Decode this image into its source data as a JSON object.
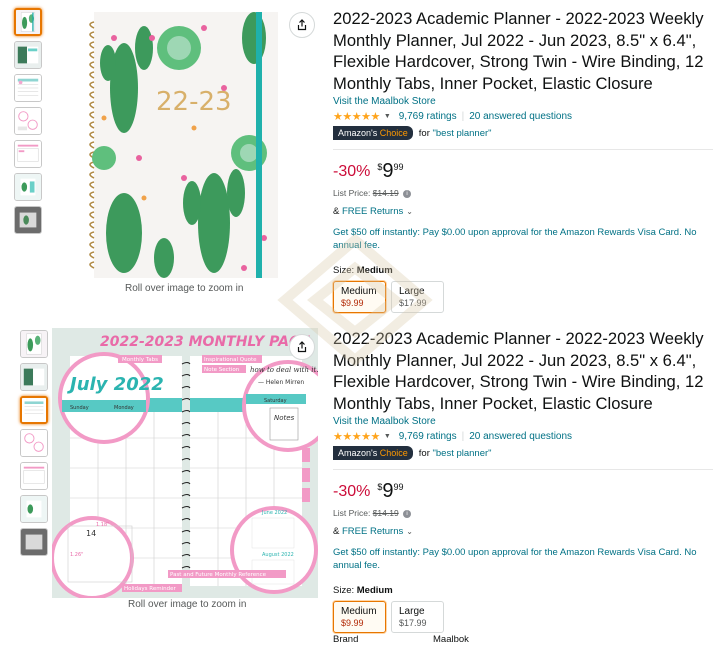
{
  "listings": [
    {
      "title": "2022-2023 Academic Planner - 2022-2023 Weekly Monthly Planner, Jul 2022 - Jun 2023, 8.5\" x 6.4\", Flexible Hardcover, Strong Twin - Wire Binding, 12 Monthly Tabs, Inner Pocket, Elastic Closure",
      "store_link": "Visit the Maalbok Store",
      "stars": "★★★★★",
      "ratings": "9,769 ratings",
      "answered": "20 answered questions",
      "choice_prefix": "Amazon's ",
      "choice_suffix": "Choice",
      "for_text": "for ",
      "for_link": "\"best planner\"",
      "discount": "-30%",
      "price_symbol": "$",
      "price_whole": "9",
      "price_fraction": "99",
      "list_price_label": "List Price: ",
      "list_price_value": "$14.19",
      "returns_prefix": "& ",
      "returns_link": "FREE Returns",
      "offer": "Get $50 off instantly: Pay $0.00 upon approval for the Amazon Rewards Visa Card. No annual fee.",
      "size_label": "Size: ",
      "size_selected": "Medium",
      "sizes": [
        {
          "name": "Medium",
          "price": "$9.99"
        },
        {
          "name": "Large",
          "price": "$17.99"
        }
      ],
      "zoom_text": "Roll over image to zoom in",
      "cover_text": "22-23"
    },
    {
      "title": "2022-2023 Academic Planner - 2022-2023 Weekly Monthly Planner, Jul 2022 - Jun 2023, 8.5\" x 6.4\", Flexible Hardcover, Strong Twin - Wire Binding, 12 Monthly Tabs, Inner Pocket, Elastic Closure",
      "store_link": "Visit the Maalbok Store",
      "stars": "★★★★★",
      "ratings": "9,769 ratings",
      "answered": "20 answered questions",
      "choice_prefix": "Amazon's ",
      "choice_suffix": "Choice",
      "for_text": "for ",
      "for_link": "\"best planner\"",
      "discount": "-30%",
      "price_symbol": "$",
      "price_whole": "9",
      "price_fraction": "99",
      "list_price_label": "List Price: ",
      "list_price_value": "$14.19",
      "returns_prefix": "& ",
      "returns_link": "FREE Returns",
      "offer": "Get $50 off instantly: Pay $0.00 upon approval for the Amazon Rewards Visa Card. No annual fee.",
      "size_label": "Size: ",
      "size_selected": "Medium",
      "sizes": [
        {
          "name": "Medium",
          "price": "$9.99"
        },
        {
          "name": "Large",
          "price": "$17.99"
        }
      ],
      "zoom_text": "Roll over image to zoom in",
      "monthly_page": {
        "heading": "2022-2023 MONTHLY PAGE",
        "month": "July 2022",
        "callouts": [
          "Monthly Tabs",
          "Inspirational Quote",
          "Note Section",
          "Past and Future Monthly Reference",
          "Holidays Reminder"
        ],
        "notes_label": "Notes",
        "quote_fragment": "how to deal with it.",
        "quote_author": "— Helen Mirren",
        "quote_lead": "\"The trick in li",
        "day_left": "Sunday",
        "day_left2": "Monday",
        "day_right": "Saturday",
        "mini_months": [
          "June 2022",
          "August 2022"
        ],
        "dim_a": "1.18\"",
        "dim_b": "1.26\"",
        "day_num": "14"
      }
    }
  ],
  "bottom_partial": {
    "label": "Brand",
    "value": "Maalbok"
  },
  "colors": {
    "link": "#007185",
    "discount": "#cc0c39",
    "star": "#ffa41c",
    "selected_border": "#e77600",
    "badge_bg": "#232f3e",
    "teal": "#1fa9a8",
    "pink": "#ee8cc0"
  },
  "icons": {
    "share": "share-icon",
    "info": "info-icon",
    "caret": "chevron-down-icon"
  }
}
